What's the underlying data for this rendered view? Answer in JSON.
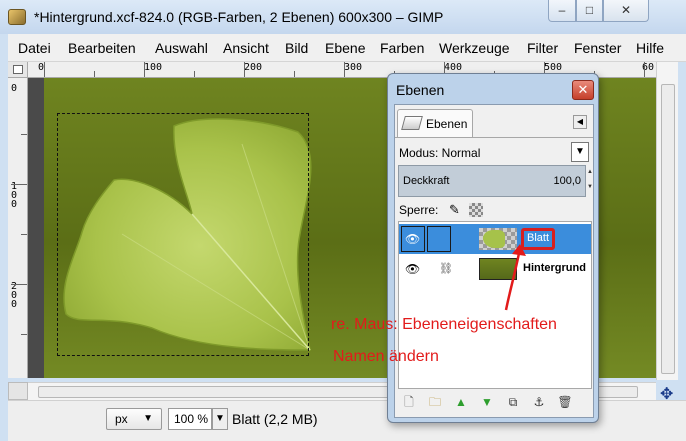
{
  "window": {
    "title": "*Hintergrund.xcf-824.0 (RGB-Farben, 2 Ebenen) 600x300 – GIMP",
    "caption_minimize": "–",
    "caption_maximize": "□",
    "caption_close": "✕"
  },
  "menubar": [
    "Datei",
    "Bearbeiten",
    "Auswahl",
    "Ansicht",
    "Bild",
    "Ebene",
    "Farben",
    "Werkzeuge",
    "Filter",
    "Fenster",
    "Hilfe"
  ],
  "ruler": {
    "top_labels": [
      "0",
      "100",
      "200",
      "300",
      "400",
      "500",
      "60"
    ],
    "left_labels": [
      "0",
      "100",
      "200"
    ]
  },
  "statusbar": {
    "unit": "px",
    "zoom": "100 %",
    "info": "Blatt (2,2 MB)"
  },
  "layers_dialog": {
    "title": "Ebenen",
    "close": "✕",
    "tab_label": "Ebenen",
    "mode_label": "Modus: Normal",
    "opacity_label": "Deckkraft",
    "opacity_value": "100,0",
    "lock_label": "Sperre:",
    "layers": [
      {
        "name": "Blatt",
        "selected": true
      },
      {
        "name": "Hintergrund",
        "selected": false
      }
    ]
  },
  "annotations": {
    "line1": "re. Maus: Ebeneneigenschaften",
    "line2": "Namen ändern"
  },
  "colors": {
    "annotation": "#e21b1b",
    "selection": "#3b8ddc",
    "canvas_green": "#6f8420"
  }
}
